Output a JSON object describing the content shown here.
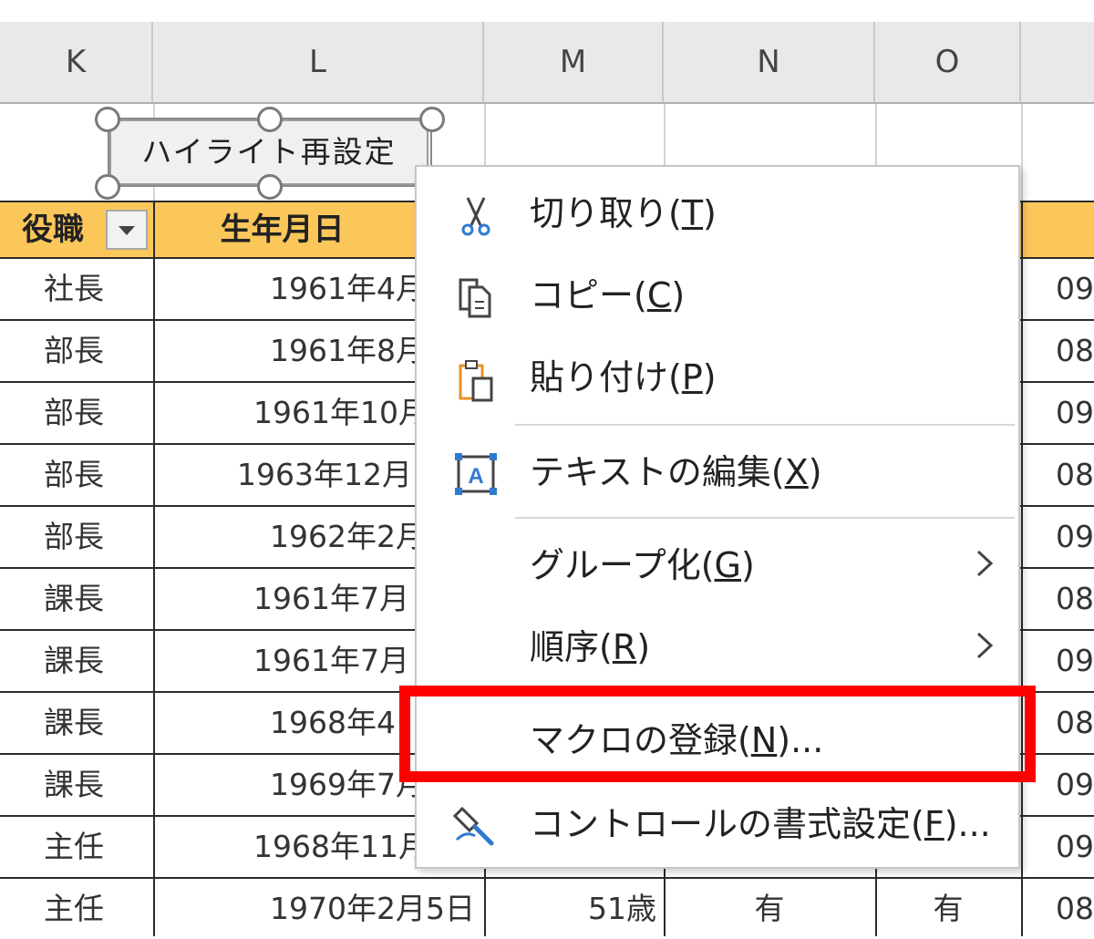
{
  "columns": [
    "K",
    "L",
    "M",
    "N",
    "O"
  ],
  "shape_button": {
    "label": "ハイライト再設定"
  },
  "table": {
    "headers": [
      "役職",
      "生年月日"
    ],
    "rows": [
      {
        "role": "社長",
        "birth": "1961年4月",
        "tail": "09"
      },
      {
        "role": "部長",
        "birth": "1961年8月",
        "tail": "08"
      },
      {
        "role": "部長",
        "birth": "1961年10月",
        "tail": "09"
      },
      {
        "role": "部長",
        "birth": "1963年12月",
        "tail": "08"
      },
      {
        "role": "部長",
        "birth": "1962年2月",
        "tail": "09"
      },
      {
        "role": "課長",
        "birth": "1961年7月",
        "tail": "08"
      },
      {
        "role": "課長",
        "birth": "1961年7月",
        "tail": "09"
      },
      {
        "role": "課長",
        "birth": "1968年4",
        "tail": "08"
      },
      {
        "role": "課長",
        "birth": "1969年7月",
        "tail": "09"
      },
      {
        "role": "主任",
        "birth": "1968年11月",
        "tail": "09"
      },
      {
        "role": "主任",
        "birth": "1970年2月5日",
        "age": "51歳",
        "n": "有",
        "o": "有",
        "tail": "08"
      }
    ]
  },
  "context_menu": {
    "items": [
      {
        "id": "cut",
        "text": "切り取り(",
        "key": "T",
        "close": ")",
        "icon": "scissors-icon"
      },
      {
        "id": "copy",
        "text": "コピー(",
        "key": "C",
        "close": ")",
        "icon": "copy-icon"
      },
      {
        "id": "paste",
        "text": "貼り付け(",
        "key": "P",
        "close": ")",
        "icon": "paste-icon"
      },
      {
        "id": "edit-text",
        "text": "テキストの編集(",
        "key": "X",
        "close": ")",
        "icon": "text-box-icon"
      },
      {
        "id": "group",
        "text": "グループ化(",
        "key": "G",
        "close": ")",
        "submenu": true
      },
      {
        "id": "order",
        "text": "順序(",
        "key": "R",
        "close": ")",
        "submenu": true
      },
      {
        "id": "assign-macro",
        "text": "マクロの登録(",
        "key": "N",
        "close": ")...",
        "highlighted": true
      },
      {
        "id": "format-control",
        "text": "コントロールの書式設定(",
        "key": "F",
        "close": ")...",
        "icon": "format-brush-icon"
      }
    ]
  },
  "colors": {
    "header_fill": "#fcc75a",
    "highlight_box": "#ff0000",
    "accent_blue": "#2f7ad1",
    "accent_orange": "#e8922a"
  }
}
